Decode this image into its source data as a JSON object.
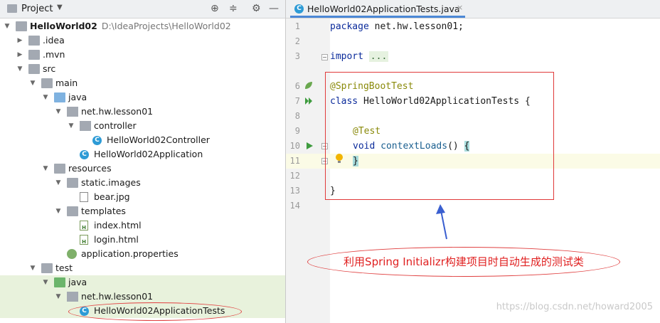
{
  "project_panel": {
    "title": "Project",
    "tree": [
      {
        "depth": 0,
        "expanded": true,
        "kind": "module",
        "label": "HelloWorld02",
        "path": "D:\\IdeaProjects\\HelloWorld02",
        "bold": true
      },
      {
        "depth": 1,
        "expanded": false,
        "kind": "folder",
        "label": ".idea"
      },
      {
        "depth": 1,
        "expanded": false,
        "kind": "folder",
        "label": ".mvn"
      },
      {
        "depth": 1,
        "expanded": true,
        "kind": "folder",
        "label": "src"
      },
      {
        "depth": 2,
        "expanded": true,
        "kind": "folder",
        "label": "main"
      },
      {
        "depth": 3,
        "expanded": true,
        "kind": "folder-blue",
        "label": "java"
      },
      {
        "depth": 4,
        "expanded": true,
        "kind": "package",
        "label": "net.hw.lesson01"
      },
      {
        "depth": 5,
        "expanded": true,
        "kind": "package",
        "label": "controller"
      },
      {
        "depth": 6,
        "kind": "class",
        "label": "HelloWorld02Controller"
      },
      {
        "depth": 5,
        "kind": "class-app",
        "label": "HelloWorld02Application"
      },
      {
        "depth": 3,
        "expanded": true,
        "kind": "folder-res",
        "label": "resources"
      },
      {
        "depth": 4,
        "expanded": true,
        "kind": "folder",
        "label": "static.images"
      },
      {
        "depth": 5,
        "kind": "file",
        "label": "bear.jpg"
      },
      {
        "depth": 4,
        "expanded": true,
        "kind": "folder",
        "label": "templates"
      },
      {
        "depth": 5,
        "kind": "html",
        "label": "index.html"
      },
      {
        "depth": 5,
        "kind": "html",
        "label": "login.html"
      },
      {
        "depth": 4,
        "kind": "props",
        "label": "application.properties"
      },
      {
        "depth": 2,
        "expanded": true,
        "kind": "folder",
        "label": "test"
      },
      {
        "depth": 3,
        "expanded": true,
        "kind": "folder-green",
        "label": "java",
        "highlight": true
      },
      {
        "depth": 4,
        "expanded": true,
        "kind": "package",
        "label": "net.hw.lesson01",
        "highlight": true
      },
      {
        "depth": 5,
        "kind": "class-app",
        "label": "HelloWorld02ApplicationTests",
        "highlight": true
      }
    ]
  },
  "editor": {
    "tab_label": "HelloWorld02ApplicationTests.java",
    "line_numbers": [
      "1",
      "2",
      "3",
      "6",
      "7",
      "8",
      "9",
      "10",
      "11",
      "12",
      "13",
      "14"
    ],
    "code": {
      "package_kw": "package",
      "package_name": " net.hw.lesson01;",
      "import_kw": "import",
      "import_fold": "...",
      "springboot_ann": "@SpringBootTest",
      "class_kw": "class",
      "class_rest": " HelloWorld02ApplicationTests {",
      "test_ann": "@Test",
      "void_kw": "void",
      "method_name": "contextLoads",
      "method_rest": "() ",
      "open_brace": "{",
      "close_brace": "}",
      "class_close": "}"
    }
  },
  "annotation": {
    "note": "利用Spring Initializr构建项目时自动生成的测试类",
    "color": "#e02020"
  },
  "watermark": "https://blog.csdn.net/howard2005"
}
